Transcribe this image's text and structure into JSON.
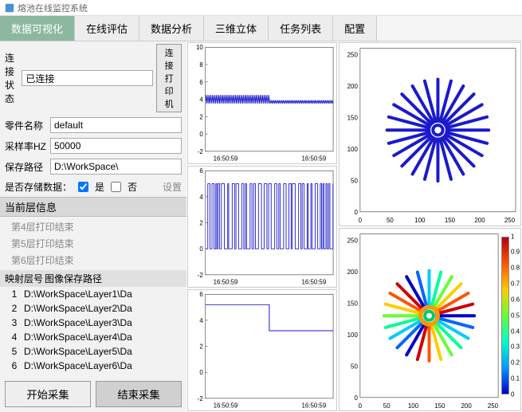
{
  "window": {
    "title": "熔池在线监控系统"
  },
  "tabs": [
    "数据可视化",
    "在线评估",
    "数据分析",
    "三维立体",
    "任务列表",
    "配置"
  ],
  "active_tab": 0,
  "form": {
    "conn_status_label": "连接状态",
    "conn_status_value": "已连接",
    "conn_button": "连接打印机",
    "part_name_label": "零件名称",
    "part_name_value": "default",
    "sample_rate_label": "采样率HZ",
    "sample_rate_value": "50000",
    "save_path_label": "保存路径",
    "save_path_value": "D:\\WorkSpace\\",
    "save_data_label": "是否存储数据：",
    "yes_label": "是",
    "no_label": "否",
    "yes_checked": true,
    "no_checked": false,
    "settings_button": "设置"
  },
  "current_layer": {
    "header": "当前层信息",
    "items": [
      "第4层打印结束",
      "第5层打印结束",
      "第6层打印结束"
    ]
  },
  "mapping": {
    "col1": "映射层号",
    "col2": "图像保存路径",
    "rows": [
      {
        "n": "1",
        "path": "D:\\WorkSpace\\Layer1\\Da"
      },
      {
        "n": "2",
        "path": "D:\\WorkSpace\\Layer2\\Da"
      },
      {
        "n": "3",
        "path": "D:\\WorkSpace\\Layer3\\Da"
      },
      {
        "n": "4",
        "path": "D:\\WorkSpace\\Layer4\\Da"
      },
      {
        "n": "5",
        "path": "D:\\WorkSpace\\Layer5\\Da"
      },
      {
        "n": "6",
        "path": "D:\\WorkSpace\\Layer6\\Da"
      }
    ]
  },
  "buttons": {
    "start": "开始采集",
    "stop": "结束采集"
  },
  "chart_data": [
    {
      "type": "line",
      "title": "signal-1",
      "ylim": [
        -2,
        10
      ],
      "yticks": [
        -2,
        0,
        2,
        4,
        6,
        8,
        10
      ],
      "xlabels": [
        "16:50:59",
        "16:50:59"
      ],
      "note": "dense oscillation ~4 first half, ~3.7 second half"
    },
    {
      "type": "line",
      "title": "signal-2",
      "ylim": [
        -2,
        6
      ],
      "yticks": [
        -2,
        0,
        2,
        4,
        6
      ],
      "xlabels": [
        "16:50:59",
        "16:50:59"
      ],
      "note": "pulse train 0↔5"
    },
    {
      "type": "line",
      "title": "signal-3",
      "ylim": [
        -2,
        6
      ],
      "yticks": [
        -2,
        0,
        2,
        4,
        6
      ],
      "xlabels": [
        "16:50:59",
        "16:50:59"
      ],
      "note": "step 5.2 → 3.2 mid"
    },
    {
      "type": "scatter",
      "title": "radial-monochrome",
      "xlim": [
        0,
        260
      ],
      "ylim": [
        0,
        260
      ],
      "xticks": [
        0,
        50,
        100,
        150,
        200,
        250
      ],
      "yticks": [
        0,
        50,
        100,
        150,
        200,
        250
      ],
      "center": [
        130,
        130
      ],
      "spokes": 24,
      "r_in": 15,
      "r_out": 85
    },
    {
      "type": "scatter",
      "title": "radial-colormap",
      "xlim": [
        0,
        260
      ],
      "ylim": [
        0,
        260
      ],
      "xticks": [
        0,
        50,
        100,
        150,
        200,
        250
      ],
      "yticks": [
        0,
        50,
        100,
        150,
        200,
        250
      ],
      "center": [
        130,
        130
      ],
      "spokes": 24,
      "r_in": 15,
      "r_out": 85,
      "colorbar": {
        "min": 0,
        "max": 1,
        "ticks": [
          0,
          0.1,
          0.2,
          0.3,
          0.4,
          0.5,
          0.6,
          0.7,
          0.8,
          0.9,
          1
        ]
      }
    }
  ]
}
